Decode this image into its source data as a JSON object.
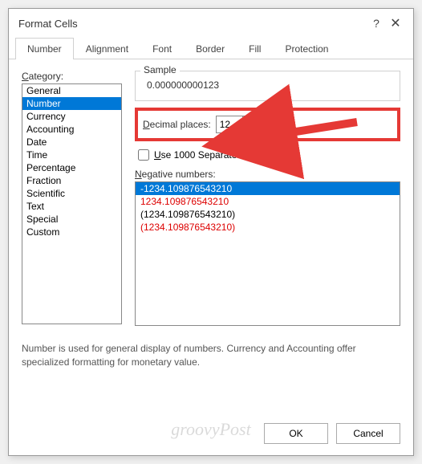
{
  "dialog": {
    "title": "Format Cells"
  },
  "tabs": {
    "items": [
      "Number",
      "Alignment",
      "Font",
      "Border",
      "Fill",
      "Protection"
    ],
    "activeIndex": 0
  },
  "category": {
    "label": "Category:",
    "items": [
      "General",
      "Number",
      "Currency",
      "Accounting",
      "Date",
      "Time",
      "Percentage",
      "Fraction",
      "Scientific",
      "Text",
      "Special",
      "Custom"
    ],
    "selectedIndex": 1
  },
  "sample": {
    "label": "Sample",
    "value": "0.000000000123"
  },
  "decimal": {
    "label": "Decimal places:",
    "value": "12"
  },
  "separator": {
    "label": "Use 1000 Separator (,)",
    "checked": false
  },
  "negative": {
    "label": "Negative numbers:",
    "items": [
      {
        "text": "-1234.109876543210",
        "red": false,
        "selected": true
      },
      {
        "text": "1234.109876543210",
        "red": true,
        "selected": false
      },
      {
        "text": "(1234.109876543210)",
        "red": false,
        "selected": false
      },
      {
        "text": "(1234.109876543210)",
        "red": true,
        "selected": false
      }
    ]
  },
  "description": "Number is used for general display of numbers.  Currency and Accounting offer specialized formatting for monetary value.",
  "buttons": {
    "ok": "OK",
    "cancel": "Cancel"
  },
  "watermark": "groovyPost"
}
